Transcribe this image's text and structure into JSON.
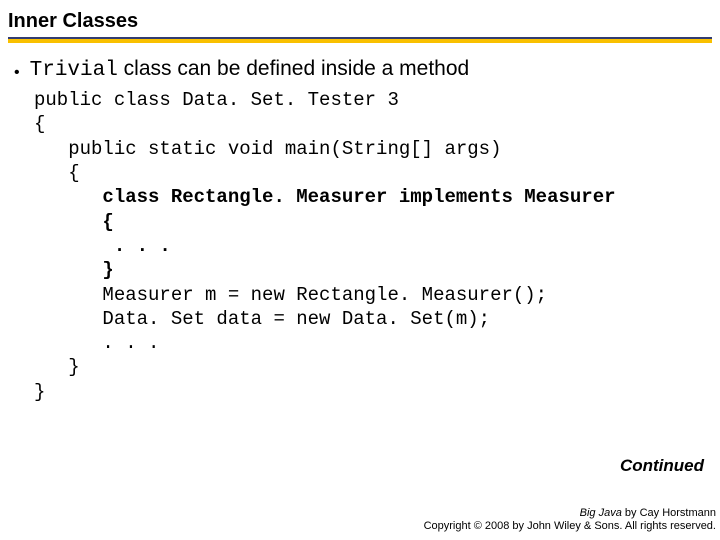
{
  "title": "Inner Classes",
  "bullet": {
    "code_word": "Trivial",
    "rest": " class can be defined inside a method"
  },
  "code": {
    "l1": "public class Data. Set. Tester 3",
    "l2": "{",
    "l3": "   public static void main(String[] args)",
    "l4": "   {",
    "l5": "      class Rectangle. Measurer implements Measurer",
    "l6": "      {",
    "l7": "       . . .",
    "l8": "      }",
    "l9": "      Measurer m = new Rectangle. Measurer();",
    "l10": "      Data. Set data = new Data. Set(m);",
    "l11": "      . . .",
    "l12": "   }",
    "l13": "}"
  },
  "continued": "Continued",
  "footer": {
    "line1_title": "Big Java",
    "line1_rest": " by Cay Horstmann",
    "line2": "Copyright © 2008 by John Wiley & Sons. All rights reserved."
  }
}
